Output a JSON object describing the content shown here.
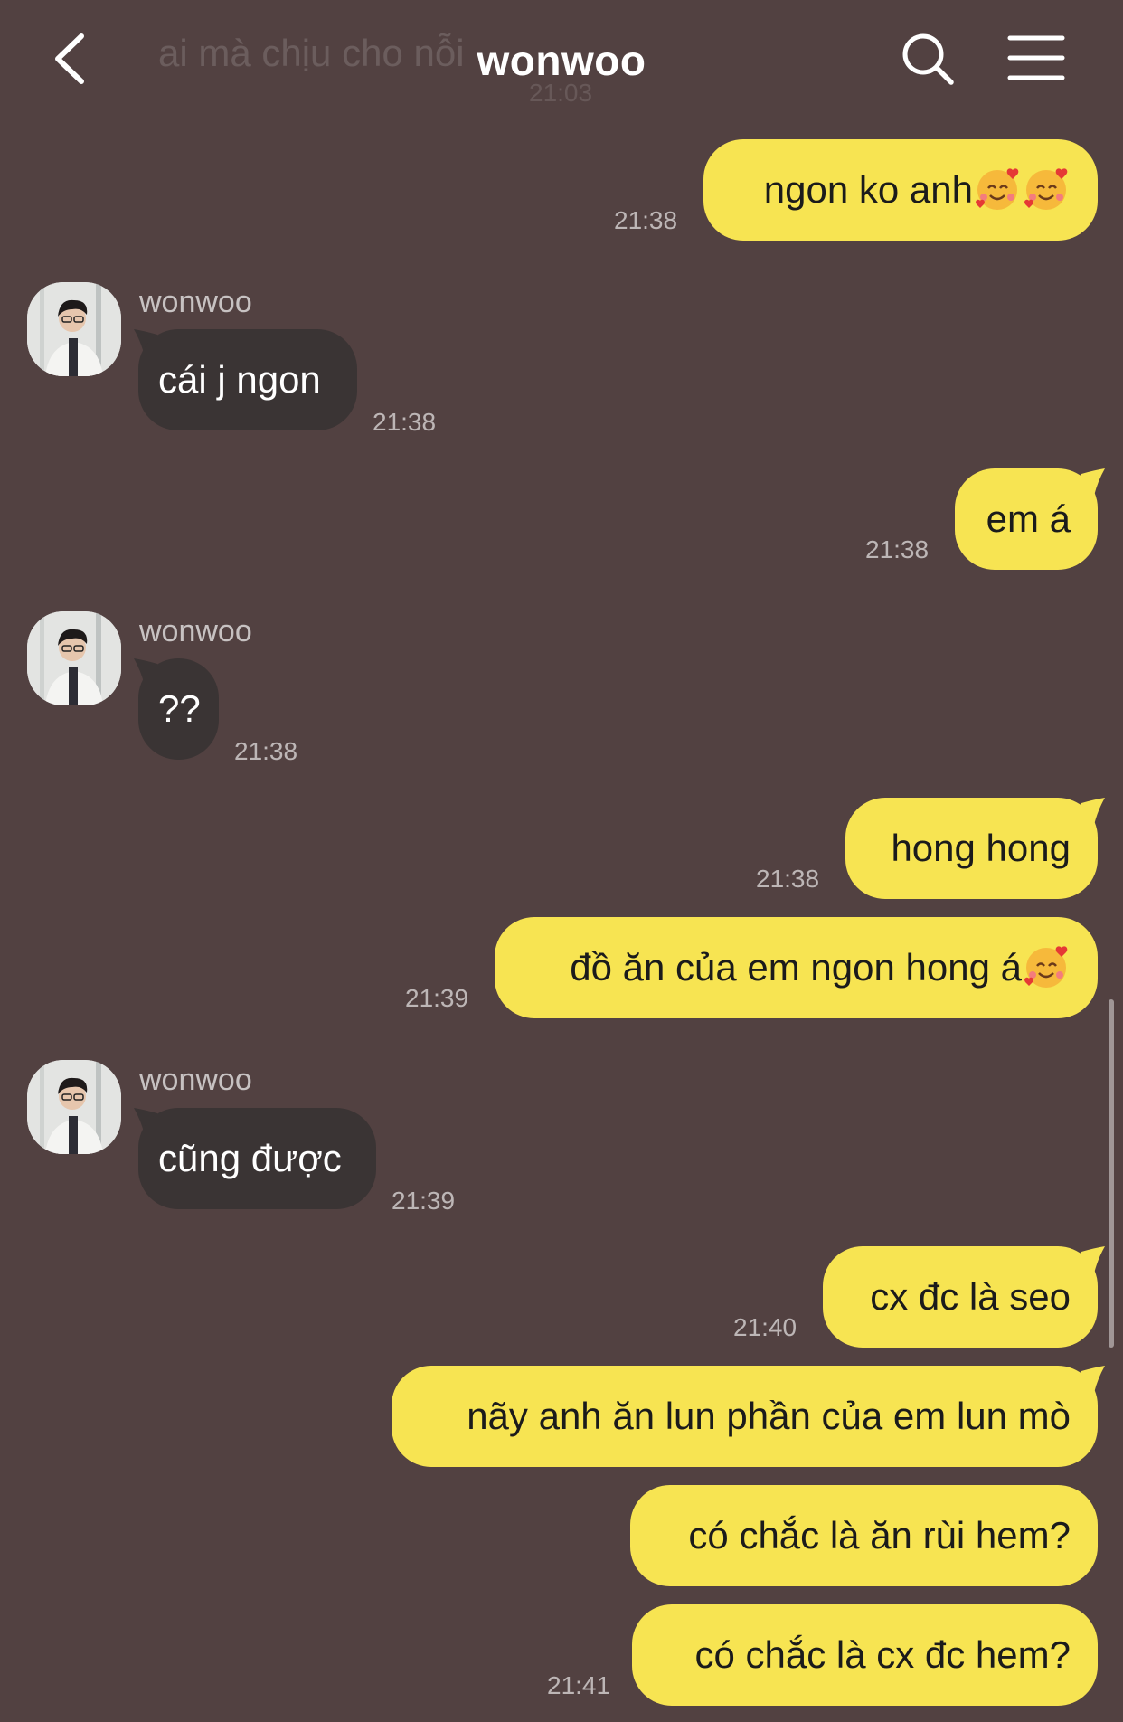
{
  "header": {
    "title": "wonwoo",
    "ghost_message": "ai mà chịu cho nỗi",
    "ghost_time": "21:03"
  },
  "colors": {
    "background": "#524141",
    "my_bubble": "#f7e452",
    "their_bubble": "#3a3434"
  },
  "contact": {
    "name": "wonwoo"
  },
  "messages": [
    {
      "from": "me",
      "text": "ngon ko anh",
      "time": "21:38",
      "emoji": [
        "smiling-face-with-hearts",
        "smiling-face-with-hearts"
      ]
    },
    {
      "from": "them",
      "sender": "wonwoo",
      "text": "cái j ngon",
      "time": "21:38"
    },
    {
      "from": "me",
      "text": "em á",
      "time": "21:38"
    },
    {
      "from": "them",
      "sender": "wonwoo",
      "text": "??",
      "time": "21:38"
    },
    {
      "from": "me",
      "text": "hong hong",
      "time": "21:38"
    },
    {
      "from": "me",
      "text": "đồ ăn của em ngon hong á",
      "time": "21:39",
      "emoji": [
        "smiling-face-with-hearts"
      ]
    },
    {
      "from": "them",
      "sender": "wonwoo",
      "text": "cũng được",
      "time": "21:39"
    },
    {
      "from": "me",
      "text": "cx đc là seo",
      "time": "21:40"
    },
    {
      "from": "me",
      "text": "nãy anh ăn lun phần của em lun mò",
      "time": ""
    },
    {
      "from": "me",
      "text": "có chắc là ăn rùi hem?",
      "time": ""
    },
    {
      "from": "me",
      "text": "có chắc là cx đc hem?",
      "time": "21:41"
    }
  ]
}
